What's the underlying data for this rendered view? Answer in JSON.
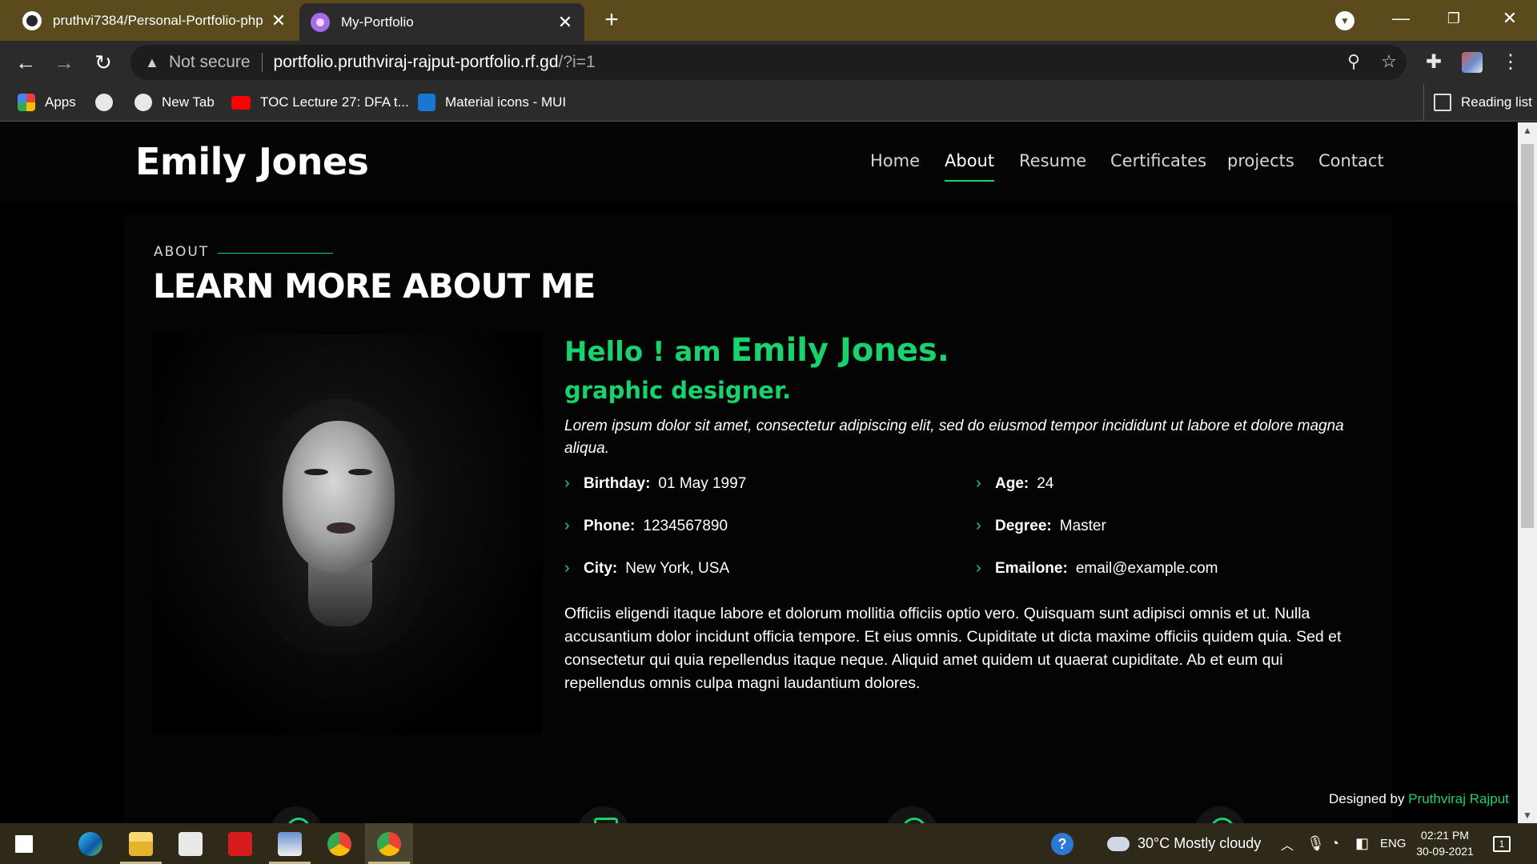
{
  "browser": {
    "tabs": [
      {
        "title": "pruthvi7384/Personal-Portfolio-php",
        "favicon": "github-icon",
        "active": false
      },
      {
        "title": "My-Portfolio",
        "favicon": "portfolio-favicon-icon",
        "active": true
      }
    ],
    "new_tab_symbol": "+",
    "omnibox": {
      "security_label": "Not secure",
      "url_host": "portfolio.pruthviraj-rajput-portfolio.rf.gd",
      "url_path": "/?i=1"
    },
    "bookmarks": [
      {
        "label": "Apps",
        "icon": "apps-grid-icon"
      },
      {
        "label": "",
        "icon": "globe-icon"
      },
      {
        "label": "New Tab",
        "icon": "globe-icon"
      },
      {
        "label": "TOC Lecture 27: DFA t...",
        "icon": "youtube-icon"
      },
      {
        "label": "Material icons - MUI",
        "icon": "mui-icon"
      }
    ],
    "reading_list_label": "Reading list"
  },
  "site": {
    "logo": "Emily Jones",
    "nav": [
      "Home",
      "About",
      "Resume",
      "Certificates",
      "projects",
      "Contact"
    ],
    "active_nav": "About",
    "accent_color": "#18d26e"
  },
  "about": {
    "section_label": "ABOUT",
    "section_title": "LEARN MORE ABOUT ME",
    "hello_prefix": "Hello ! am ",
    "name": "Emily Jones.",
    "role": "graphic designer.",
    "intro": "Lorem ipsum dolor sit amet, consectetur adipiscing elit, sed do eiusmod tempor incididunt ut labore et dolore magna aliqua.",
    "details": [
      {
        "key": "Birthday:",
        "value": "01 May 1997"
      },
      {
        "key": "Age:",
        "value": "24"
      },
      {
        "key": "Phone:",
        "value": "1234567890"
      },
      {
        "key": "Degree:",
        "value": "Master"
      },
      {
        "key": "City:",
        "value": "New York, USA"
      },
      {
        "key": "Emailone:",
        "value": "email@example.com"
      }
    ],
    "bio": "Officiis eligendi itaque labore et dolorum mollitia officiis optio vero. Quisquam sunt adipisci omnis et ut. Nulla accusantium dolor incidunt officia tempore. Et eius omnis. Cupiditate ut dicta maxime officiis quidem quia. Sed et consectetur qui quia repellendus itaque neque. Aliquid amet quidem ut quaerat cupiditate. Ab et eum qui repellendus omnis culpa magni laudantium dolores."
  },
  "footer": {
    "credit_prefix": "Designed by ",
    "credit_author": "Pruthviraj Rajput"
  },
  "taskbar": {
    "weather": "30°C  Mostly cloudy",
    "language": "ENG",
    "time": "02:21 PM",
    "date": "30-09-2021",
    "notification_count": "1"
  }
}
